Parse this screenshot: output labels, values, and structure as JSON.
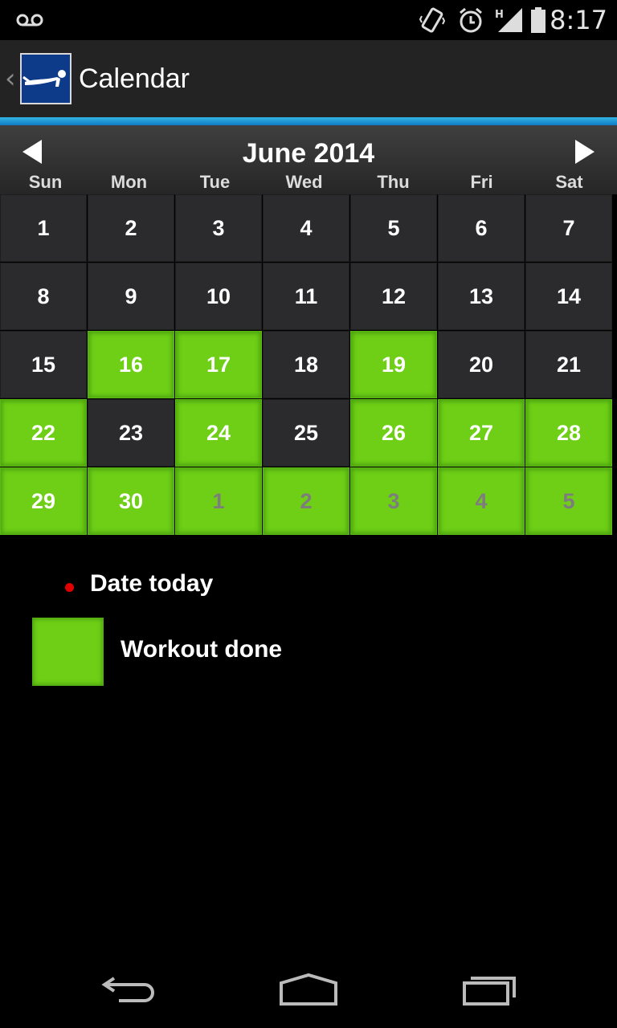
{
  "status_bar": {
    "time": "8:17",
    "network_label": "H",
    "icons": [
      "voicemail-icon",
      "vibrate-icon",
      "alarm-icon",
      "signal-icon",
      "battery-icon"
    ]
  },
  "action_bar": {
    "title": "Calendar",
    "back_label": "‹",
    "logo_icon": "pushup-figure-icon"
  },
  "calendar": {
    "month_title": "June 2014",
    "prev_icon": "prev-month-icon",
    "next_icon": "next-month-icon",
    "weekdays": [
      "Sun",
      "Mon",
      "Tue",
      "Wed",
      "Thu",
      "Fri",
      "Sat"
    ],
    "weeks": [
      [
        {
          "day": "1",
          "done": false,
          "other": false
        },
        {
          "day": "2",
          "done": false,
          "other": false
        },
        {
          "day": "3",
          "done": false,
          "other": false
        },
        {
          "day": "4",
          "done": false,
          "other": false
        },
        {
          "day": "5",
          "done": false,
          "other": false
        },
        {
          "day": "6",
          "done": false,
          "other": false
        },
        {
          "day": "7",
          "done": false,
          "other": false
        }
      ],
      [
        {
          "day": "8",
          "done": false,
          "other": false
        },
        {
          "day": "9",
          "done": false,
          "other": false
        },
        {
          "day": "10",
          "done": false,
          "other": false
        },
        {
          "day": "11",
          "done": false,
          "other": false
        },
        {
          "day": "12",
          "done": false,
          "other": false
        },
        {
          "day": "13",
          "done": false,
          "other": false
        },
        {
          "day": "14",
          "done": false,
          "other": false
        }
      ],
      [
        {
          "day": "15",
          "done": false,
          "other": false
        },
        {
          "day": "16",
          "done": true,
          "other": false
        },
        {
          "day": "17",
          "done": true,
          "other": false
        },
        {
          "day": "18",
          "done": false,
          "other": false
        },
        {
          "day": "19",
          "done": true,
          "other": false
        },
        {
          "day": "20",
          "done": false,
          "other": false
        },
        {
          "day": "21",
          "done": false,
          "other": false
        }
      ],
      [
        {
          "day": "22",
          "done": true,
          "other": false
        },
        {
          "day": "23",
          "done": false,
          "other": false
        },
        {
          "day": "24",
          "done": true,
          "other": false
        },
        {
          "day": "25",
          "done": false,
          "other": false
        },
        {
          "day": "26",
          "done": true,
          "other": false
        },
        {
          "day": "27",
          "done": true,
          "other": false
        },
        {
          "day": "28",
          "done": true,
          "other": false
        }
      ],
      [
        {
          "day": "29",
          "done": true,
          "other": false
        },
        {
          "day": "30",
          "done": true,
          "other": false
        },
        {
          "day": "1",
          "done": true,
          "other": true
        },
        {
          "day": "2",
          "done": true,
          "other": true
        },
        {
          "day": "3",
          "done": true,
          "other": true
        },
        {
          "day": "4",
          "done": true,
          "other": true
        },
        {
          "day": "5",
          "done": true,
          "other": true
        }
      ]
    ]
  },
  "legend": {
    "today_label": "Date today",
    "done_label": "Workout done",
    "today_color": "#e00000",
    "done_color": "#6ecf16"
  },
  "nav_bar": {
    "icons": [
      "back-icon",
      "home-icon",
      "recent-apps-icon"
    ]
  },
  "colors": {
    "accent_blue": "#33b5e5",
    "workout_green": "#6ecf16",
    "cell_dark": "#2b2b2d"
  }
}
